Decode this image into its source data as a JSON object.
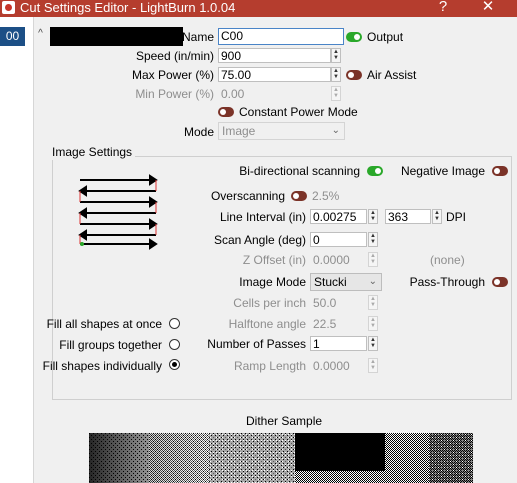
{
  "window": {
    "title": "Cut Settings Editor - LightBurn 1.0.04",
    "help_label": "?",
    "close_label": "✕"
  },
  "layer_list": {
    "selected": "00",
    "scroll_up": "^"
  },
  "name": {
    "label": "Name",
    "value": "C00"
  },
  "output": {
    "label": "Output",
    "on": true
  },
  "speed": {
    "label": "Speed (in/min)",
    "value": "900"
  },
  "max_power": {
    "label": "Max Power (%)",
    "value": "75.00"
  },
  "air_assist": {
    "label": "Air Assist",
    "on": false
  },
  "min_power": {
    "label": "Min Power (%)",
    "value": "0.00"
  },
  "constant_power": {
    "label": "Constant Power Mode",
    "on": false
  },
  "mode": {
    "label": "Mode",
    "value": "Image"
  },
  "image_settings": {
    "title": "Image Settings",
    "bidirectional": {
      "label": "Bi-directional scanning",
      "on": true
    },
    "negative_image": {
      "label": "Negative Image",
      "on": false
    },
    "overscanning": {
      "label": "Overscanning",
      "value": "2.5%",
      "on": false
    },
    "line_interval": {
      "label": "Line Interval (in)",
      "value": "0.00275",
      "dpi_value": "363",
      "dpi_label": "DPI"
    },
    "scan_angle": {
      "label": "Scan Angle (deg)",
      "value": "0"
    },
    "z_offset": {
      "label": "Z Offset (in)",
      "value": "0.0000",
      "extra": "(none)"
    },
    "image_mode": {
      "label": "Image Mode",
      "value": "Stucki"
    },
    "pass_through": {
      "label": "Pass-Through",
      "on": false
    },
    "cells_per_inch": {
      "label": "Cells per inch",
      "value": "50.0"
    },
    "halftone_angle": {
      "label": "Halftone angle",
      "value": "22.5"
    },
    "number_of_passes": {
      "label": "Number of Passes",
      "value": "1"
    },
    "ramp_length": {
      "label": "Ramp Length",
      "value": "0.0000"
    },
    "fill_all": {
      "label": "Fill all shapes at once",
      "checked": false
    },
    "fill_groups": {
      "label": "Fill groups together",
      "checked": false
    },
    "fill_individually": {
      "label": "Fill shapes individually",
      "checked": true
    }
  },
  "dither": {
    "title": "Dither Sample"
  },
  "colors": {
    "titlebar": "#b53d2e",
    "toggle_on": "#2aa82a",
    "toggle_off": "#7b3328",
    "selection": "#1c4f86"
  }
}
